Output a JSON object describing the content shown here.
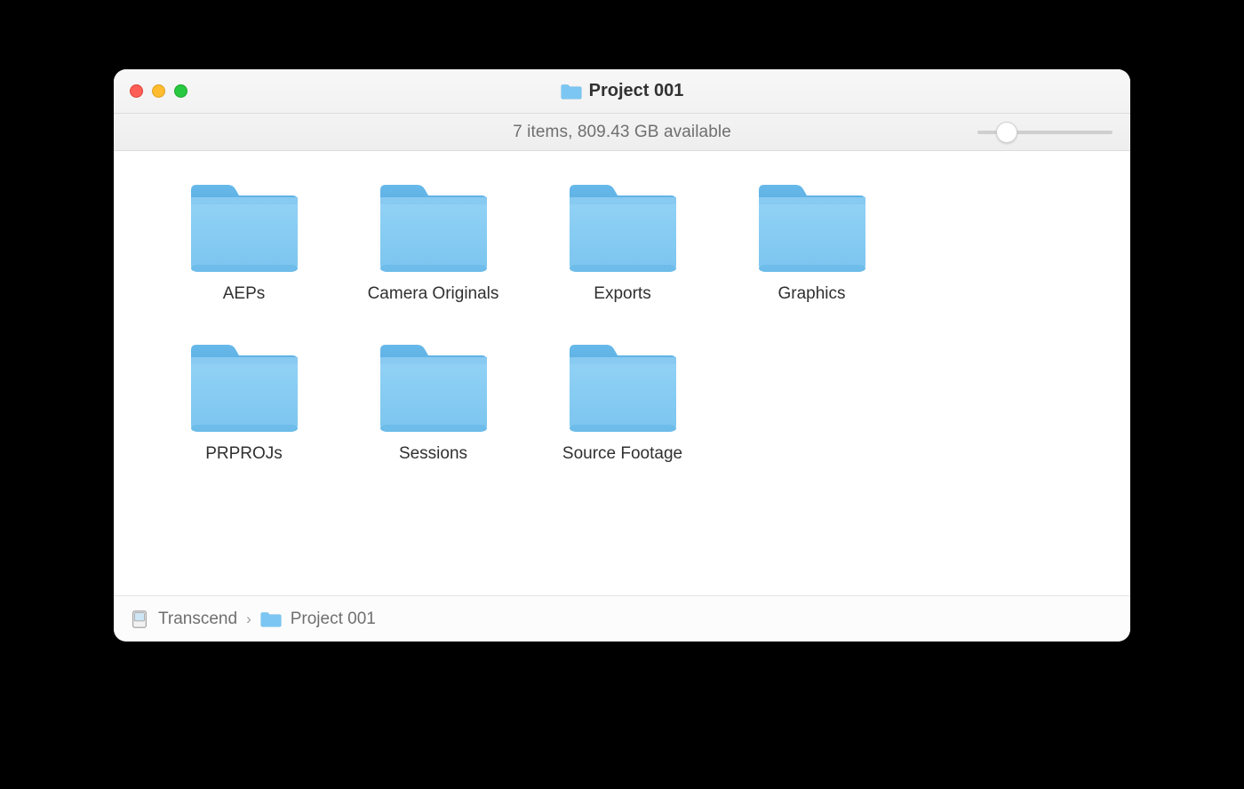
{
  "window": {
    "title": "Project 001"
  },
  "status": {
    "text": "7 items, 809.43 GB available"
  },
  "folders": [
    {
      "label": "AEPs"
    },
    {
      "label": "Camera Originals"
    },
    {
      "label": "Exports"
    },
    {
      "label": "Graphics"
    },
    {
      "label": "PRPROJs"
    },
    {
      "label": "Sessions"
    },
    {
      "label": "Source Footage"
    }
  ],
  "path": {
    "root": "Transcend",
    "current": "Project 001"
  }
}
